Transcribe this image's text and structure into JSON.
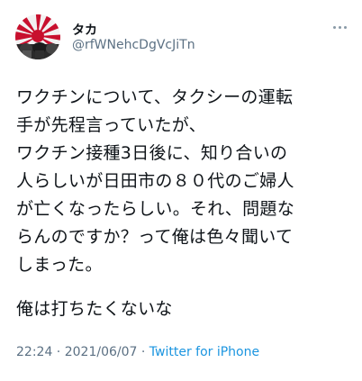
{
  "user": {
    "display_name": "タカ",
    "handle": "@rfWNehcDgVcJiTn"
  },
  "tweet": {
    "text": "ワクチンについて、タクシーの運転\n手が先程言っていたが、\nワクチン接種3日後に、知り合いの\n人らしいが日田市の８０代のご婦人\nが亡くなったらしい。それ、問題な\nらんのですか？って俺は色々聞いて\nしまった。",
    "text2": "俺は打ちたくないな"
  },
  "meta": {
    "time": "22:24",
    "separator1": " · ",
    "date": "2021/06/07",
    "separator2": " · ",
    "source": "Twitter for iPhone"
  },
  "icons": {
    "avatar": "rising-sun-flag-avatar",
    "more": "more-horizontal-icon"
  }
}
